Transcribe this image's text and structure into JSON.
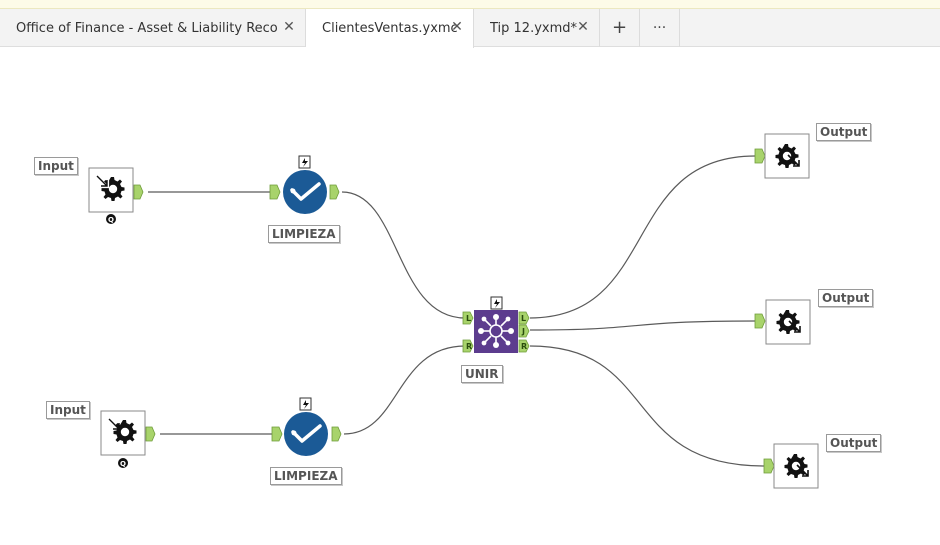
{
  "tabs": [
    {
      "label": "Office of Finance - Asset & Liability Reco...",
      "active": false,
      "close": "✕"
    },
    {
      "label": "ClientesVentas.yxmc",
      "active": true,
      "close": "✕"
    },
    {
      "label": "Tip 12.yxmd*",
      "active": false,
      "close": "✕"
    }
  ],
  "tab_actions": {
    "add": "+",
    "more": "···"
  },
  "canvas": {
    "input_tools": [
      {
        "label": "Input",
        "icon": "input-gear-icon",
        "badge": "Q"
      },
      {
        "label": "Input",
        "icon": "input-gear-icon",
        "badge": "Q"
      }
    ],
    "cleanse_tools": [
      {
        "label": "LIMPIEZA",
        "icon": "data-cleansing-icon"
      },
      {
        "label": "LIMPIEZA",
        "icon": "data-cleansing-icon"
      }
    ],
    "join_tool": {
      "label": "UNIR",
      "icon": "join-icon",
      "anchors_in": [
        "L",
        "R"
      ],
      "anchors_out": [
        "L",
        "J",
        "R"
      ]
    },
    "output_tools": [
      {
        "label": "Output",
        "icon": "output-gear-icon"
      },
      {
        "label": "Output",
        "icon": "output-gear-icon"
      },
      {
        "label": "Output",
        "icon": "output-gear-icon"
      }
    ],
    "colors": {
      "anchor": "#a8d36b",
      "cleanse": "#1b5a96",
      "join": "#5c3c8e",
      "connection": "#5a5a5a"
    }
  }
}
